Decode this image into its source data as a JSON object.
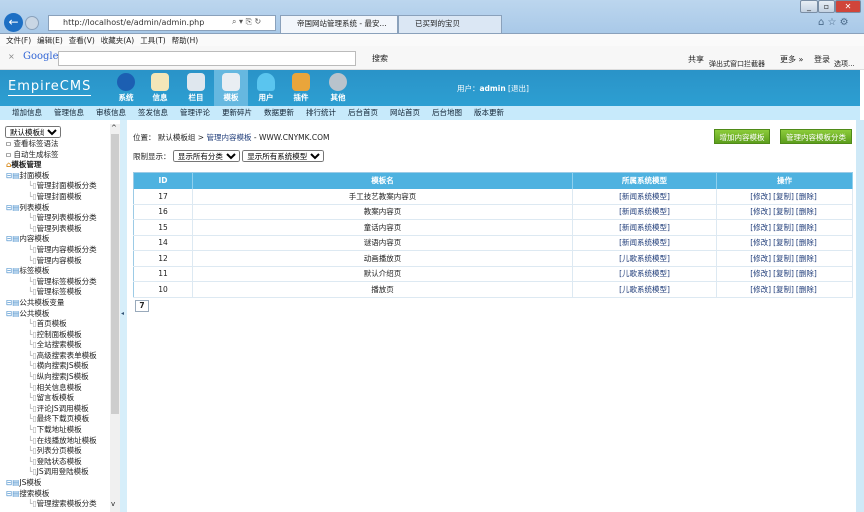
{
  "browser": {
    "url": "http://localhost/e/admin/admin.php",
    "tabs": [
      "帝国网站管理系统 - 最安...",
      "已买到的宝贝"
    ],
    "menu": [
      "文件(F)",
      "编辑(E)",
      "查看(V)",
      "收藏夹(A)",
      "工具(T)",
      "帮助(H)"
    ],
    "google": {
      "brand": "Google",
      "search_label": "搜索",
      "share": "共享",
      "popup_blocker": "弹出式窗口拦截器",
      "more": "更多 »",
      "login": "登录",
      "options": "选项..."
    }
  },
  "cms": {
    "logo": "EmpireCMS",
    "nav": [
      "系统",
      "信息",
      "栏目",
      "模板",
      "用户",
      "插件",
      "其他"
    ],
    "active_nav": "模板",
    "user_label": "用户：",
    "user": "admin",
    "logout": "[退出]",
    "subnav": [
      "增加信息",
      "管理信息",
      "审核信息",
      "签发信息",
      "管理评论",
      "更新碎片",
      "数据更新",
      "排行统计",
      "后台首页",
      "网站首页",
      "后台地图",
      "版本更新"
    ]
  },
  "sidebar": {
    "group_select": "默认模板组",
    "links": [
      "查看标签语法",
      "自动生成标签"
    ],
    "root": "模板管理",
    "tree": [
      {
        "l": 0,
        "t": "封面模板"
      },
      {
        "l": 1,
        "t": "管理封面模板分类"
      },
      {
        "l": 1,
        "t": "管理封面模板"
      },
      {
        "l": 0,
        "t": "列表模板"
      },
      {
        "l": 1,
        "t": "管理列表模板分类"
      },
      {
        "l": 1,
        "t": "管理列表模板"
      },
      {
        "l": 0,
        "t": "内容模板"
      },
      {
        "l": 1,
        "t": "管理内容模板分类"
      },
      {
        "l": 1,
        "t": "管理内容模板"
      },
      {
        "l": 0,
        "t": "标签模板"
      },
      {
        "l": 1,
        "t": "管理标签模板分类"
      },
      {
        "l": 1,
        "t": "管理标签模板"
      },
      {
        "l": 0,
        "t": "公共模板变量"
      },
      {
        "l": 0,
        "t": "公共模板"
      },
      {
        "l": 1,
        "t": "首页模板"
      },
      {
        "l": 1,
        "t": "控制面板模板"
      },
      {
        "l": 1,
        "t": "全站搜索模板"
      },
      {
        "l": 1,
        "t": "高级搜索表单模板"
      },
      {
        "l": 1,
        "t": "横向搜索JS模板"
      },
      {
        "l": 1,
        "t": "纵向搜索JS模板"
      },
      {
        "l": 1,
        "t": "相关信息模板"
      },
      {
        "l": 1,
        "t": "留言板模板"
      },
      {
        "l": 1,
        "t": "评论JS调用模板"
      },
      {
        "l": 1,
        "t": "最终下载页模板"
      },
      {
        "l": 1,
        "t": "下载地址模板"
      },
      {
        "l": 1,
        "t": "在线播放地址模板"
      },
      {
        "l": 1,
        "t": "列表分页模板"
      },
      {
        "l": 1,
        "t": "登陆状态模板"
      },
      {
        "l": 1,
        "t": "JS调用登陆模板"
      },
      {
        "l": 0,
        "t": "JS模板"
      },
      {
        "l": 0,
        "t": "搜索模板"
      },
      {
        "l": 1,
        "t": "管理搜索模板分类"
      }
    ]
  },
  "main": {
    "location_label": "位置：",
    "breadcrumb": [
      "默认模板组",
      ">",
      "管理内容模板"
    ],
    "site": "- WWW.CNYMK.COM",
    "add_button": "增加内容模板",
    "manage_class_button": "管理内容模板分类",
    "filter_label": "限制显示：",
    "filter_class": "显示所有分类",
    "filter_model": "显示所有系统模型",
    "columns": [
      "ID",
      "模板名",
      "所属系统模型",
      "操作"
    ],
    "rows": [
      {
        "id": "17",
        "name": "手工技艺教案内容页",
        "model": "[新闻系统模型]"
      },
      {
        "id": "16",
        "name": "教案内容页",
        "model": "[新闻系统模型]"
      },
      {
        "id": "15",
        "name": "童话内容页",
        "model": "[新闻系统模型]"
      },
      {
        "id": "14",
        "name": "谜语内容页",
        "model": "[新闻系统模型]"
      },
      {
        "id": "12",
        "name": "动画播放页",
        "model": "[儿歌系统模型]"
      },
      {
        "id": "11",
        "name": "默认介绍页",
        "model": "[儿歌系统模型]"
      },
      {
        "id": "10",
        "name": "播放页",
        "model": "[儿歌系统模型]"
      }
    ],
    "actions": [
      "[修改]",
      "[复制]",
      "[删除]"
    ],
    "pager": "7"
  }
}
